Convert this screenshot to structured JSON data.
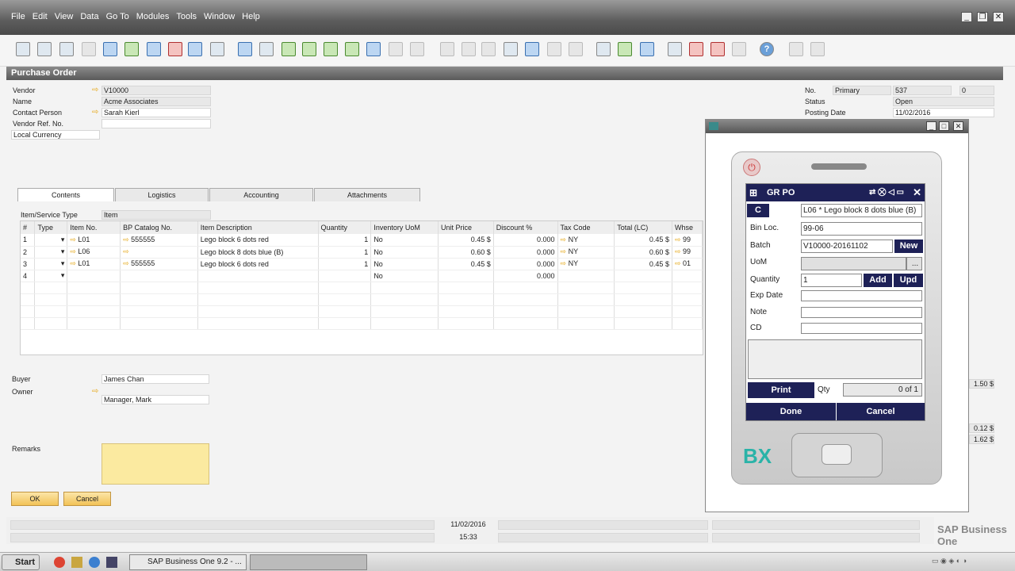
{
  "menu": [
    "File",
    "Edit",
    "View",
    "Data",
    "Go To",
    "Modules",
    "Tools",
    "Window",
    "Help"
  ],
  "form_title": "Purchase Order",
  "header": {
    "vendor_label": "Vendor",
    "vendor": "V10000",
    "name_label": "Name",
    "name": "Acme Associates",
    "contact_label": "Contact Person",
    "contact": "Sarah Kierl",
    "ref_label": "Vendor Ref. No.",
    "currency": "Local Currency",
    "no_label": "No.",
    "series": "Primary",
    "doc_no": "537",
    "doc_no2": "0",
    "status_label": "Status",
    "status": "Open",
    "posting_label": "Posting Date",
    "posting": "11/02/2016"
  },
  "tabs": [
    "Contents",
    "Logistics",
    "Accounting",
    "Attachments"
  ],
  "item_type_label": "Item/Service Type",
  "item_type": "Item",
  "columns": [
    "#",
    "Type",
    "Item No.",
    "BP Catalog No.",
    "Item Description",
    "Quantity",
    "Inventory UoM",
    "Unit Price",
    "Discount %",
    "Tax Code",
    "Total (LC)",
    "Whse"
  ],
  "rows": [
    {
      "n": "1",
      "item": "L01",
      "cat": "555555",
      "desc": "Lego block 6 dots red",
      "qty": "1",
      "uom": "No",
      "price": "0.45 $",
      "disc": "0.000",
      "tax": "NY",
      "total": "0.45 $",
      "whse": "99"
    },
    {
      "n": "2",
      "item": "L06",
      "cat": "",
      "desc": "Lego block 8 dots blue (B)",
      "qty": "1",
      "uom": "No",
      "price": "0.60 $",
      "disc": "0.000",
      "tax": "NY",
      "total": "0.60 $",
      "whse": "99"
    },
    {
      "n": "3",
      "item": "L01",
      "cat": "555555",
      "desc": "Lego block 6 dots red",
      "qty": "1",
      "uom": "No",
      "price": "0.45 $",
      "disc": "0.000",
      "tax": "NY",
      "total": "0.45 $",
      "whse": "01"
    },
    {
      "n": "4",
      "item": "",
      "cat": "",
      "desc": "",
      "qty": "",
      "uom": "No",
      "price": "",
      "disc": "0.000",
      "tax": "",
      "total": "",
      "whse": ""
    }
  ],
  "footer": {
    "buyer_label": "Buyer",
    "buyer": "James Chan",
    "owner_label": "Owner",
    "owner": "Manager, Mark",
    "remarks_label": "Remarks",
    "ok": "OK",
    "cancel": "Cancel",
    "v1": "1.50 $",
    "v2": "0.12 $",
    "v3": "1.62 $"
  },
  "statusbar": {
    "date": "11/02/2016",
    "time": "15:33"
  },
  "sap_logo": "SAP Business One",
  "device": {
    "title": "GR PO",
    "c_btn": "C",
    "item": "L06 * Lego block 8 dots blue (B)",
    "bin_label": "Bin Loc.",
    "bin": "99-06",
    "batch_label": "Batch",
    "batch": "V10000-20161102",
    "new": "New",
    "uom_label": "UoM",
    "uom_btn": "...",
    "qty_label": "Quantity",
    "qty": "1",
    "add": "Add",
    "upd": "Upd",
    "exp_label": "Exp Date",
    "note_label": "Note",
    "cd_label": "CD",
    "print": "Print",
    "qty2_label": "Qty",
    "qty2": "0 of 1",
    "done": "Done",
    "cancel": "Cancel",
    "brand": "BX"
  },
  "taskbar": {
    "start": "Start",
    "task1": "SAP Business One 9.2 - ..."
  }
}
